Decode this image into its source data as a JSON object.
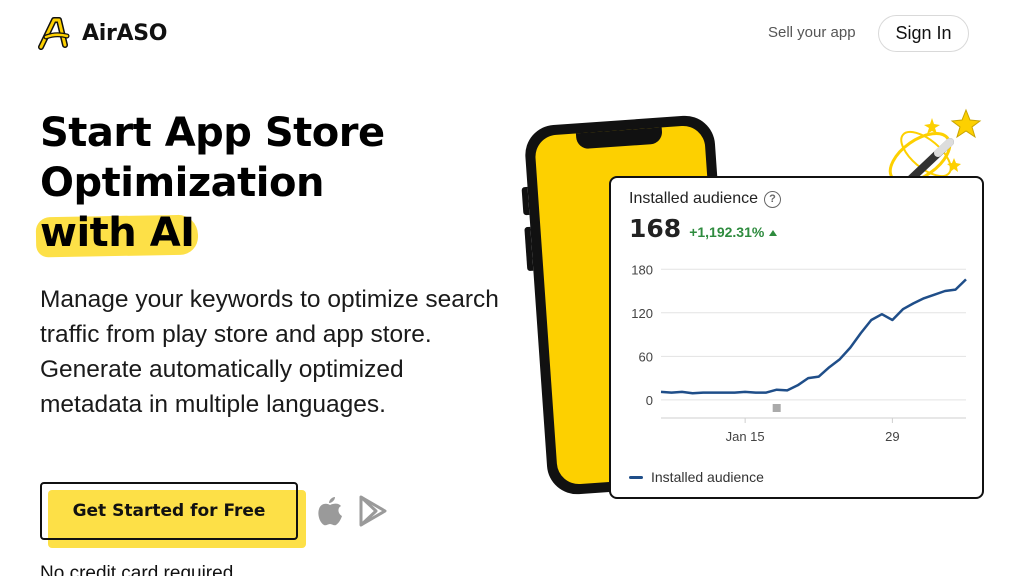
{
  "header": {
    "brand_name": "AirASO",
    "sell_link": "Sell your app",
    "signin_label": "Sign In"
  },
  "hero": {
    "headline_line1": "Start App Store",
    "headline_line2": "Optimization",
    "headline_line3": "with AI",
    "subtext": "Manage your keywords to optimize search traffic from play store and app store. Generate automatically optimized metadata in multiple languages.",
    "cta_label": "Get Started for Free",
    "no_cc_note": "No credit card required"
  },
  "icons": {
    "logo": "airaso-logo-icon",
    "apple": "apple-icon",
    "play": "google-play-icon",
    "wand": "magic-wand-icon",
    "help": "help-icon"
  },
  "card": {
    "title": "Installed audience",
    "help_glyph": "?",
    "metric_value": "168",
    "metric_change": "+1,192.31%",
    "legend_label": "Installed audience"
  },
  "colors": {
    "brand_yellow": "#fde047",
    "phone_yellow": "#fdd000",
    "line_blue": "#1f4e89",
    "positive_green": "#2e8b3e"
  },
  "chart_data": {
    "type": "line",
    "title": "Installed audience",
    "xlabel": "",
    "ylabel": "",
    "ylim": [
      -25,
      190
    ],
    "y_ticks": [
      "180",
      "120",
      "60",
      "0"
    ],
    "y_tick_values": [
      180,
      120,
      60,
      0
    ],
    "x_tick_labels": [
      "Jan 15",
      "29"
    ],
    "x_tick_days": [
      8,
      22
    ],
    "series": [
      {
        "name": "Installed audience",
        "color": "#1f4e89",
        "x": [
          0,
          1,
          2,
          3,
          4,
          5,
          6,
          7,
          8,
          9,
          10,
          11,
          12,
          13,
          14,
          15,
          16,
          17,
          18,
          19,
          20,
          21,
          22,
          23,
          24,
          25,
          26,
          27,
          28,
          29
        ],
        "y": [
          11,
          10,
          11,
          9,
          10,
          10,
          10,
          10,
          11,
          10,
          10,
          14,
          13,
          20,
          30,
          32,
          45,
          56,
          72,
          92,
          110,
          118,
          110,
          125,
          133,
          140,
          145,
          150,
          152,
          166
        ]
      }
    ],
    "grid": true,
    "legend": "bottom-left"
  }
}
